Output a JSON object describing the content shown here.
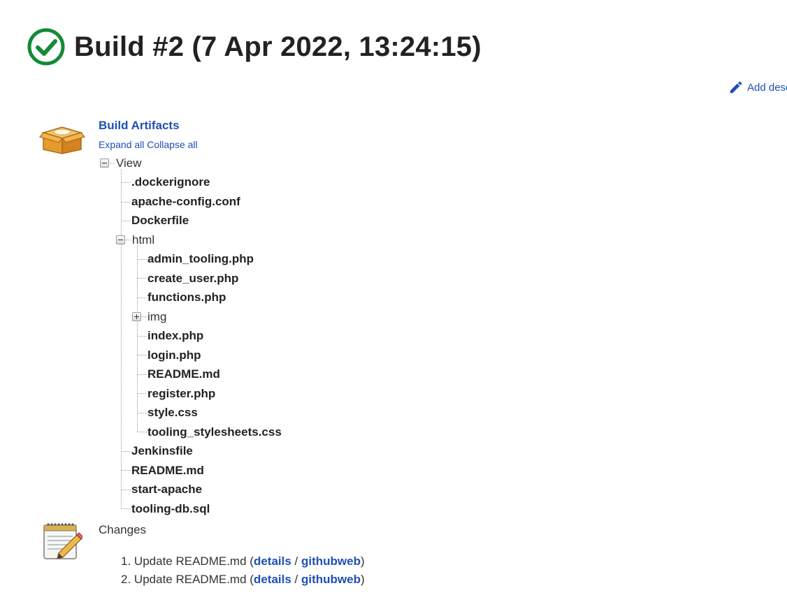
{
  "page": {
    "title": "Build #2 (7 Apr 2022, 13:24:15)",
    "status_icon": "success-check-circle-icon",
    "status_color": "#138a36"
  },
  "description": {
    "add_label": "Add description",
    "icon": "pencil-icon"
  },
  "artifacts": {
    "title": "Build Artifacts",
    "expand_all": "Expand all",
    "collapse_all": "Collapse all",
    "icon": "package-box-icon",
    "tree": {
      "root": {
        "name": "View",
        "expanded": true
      },
      "items": [
        {
          "name": ".dockerignore",
          "type": "file"
        },
        {
          "name": "apache-config.conf",
          "type": "file"
        },
        {
          "name": "Dockerfile",
          "type": "file"
        },
        {
          "name": "html",
          "type": "dir",
          "expanded": true
        },
        {
          "name": "admin_tooling.php",
          "type": "file"
        },
        {
          "name": "create_user.php",
          "type": "file"
        },
        {
          "name": "functions.php",
          "type": "file"
        },
        {
          "name": "img",
          "type": "dir",
          "expanded": false
        },
        {
          "name": "index.php",
          "type": "file"
        },
        {
          "name": "login.php",
          "type": "file"
        },
        {
          "name": "README.md",
          "type": "file"
        },
        {
          "name": "register.php",
          "type": "file"
        },
        {
          "name": "style.css",
          "type": "file"
        },
        {
          "name": "tooling_stylesheets.css",
          "type": "file"
        },
        {
          "name": "Jenkinsfile",
          "type": "file"
        },
        {
          "name": "README.md",
          "type": "file"
        },
        {
          "name": "start-apache",
          "type": "file"
        },
        {
          "name": "tooling-db.sql",
          "type": "file"
        }
      ]
    }
  },
  "changes": {
    "title": "Changes",
    "icon": "notepad-pencil-icon",
    "items": [
      {
        "number": "1.",
        "message": "Update README.md",
        "details": "details",
        "sep": "/",
        "githubweb": "githubweb"
      },
      {
        "number": "2.",
        "message": "Update README.md",
        "details": "details",
        "sep": "/",
        "githubweb": "githubweb"
      }
    ]
  }
}
